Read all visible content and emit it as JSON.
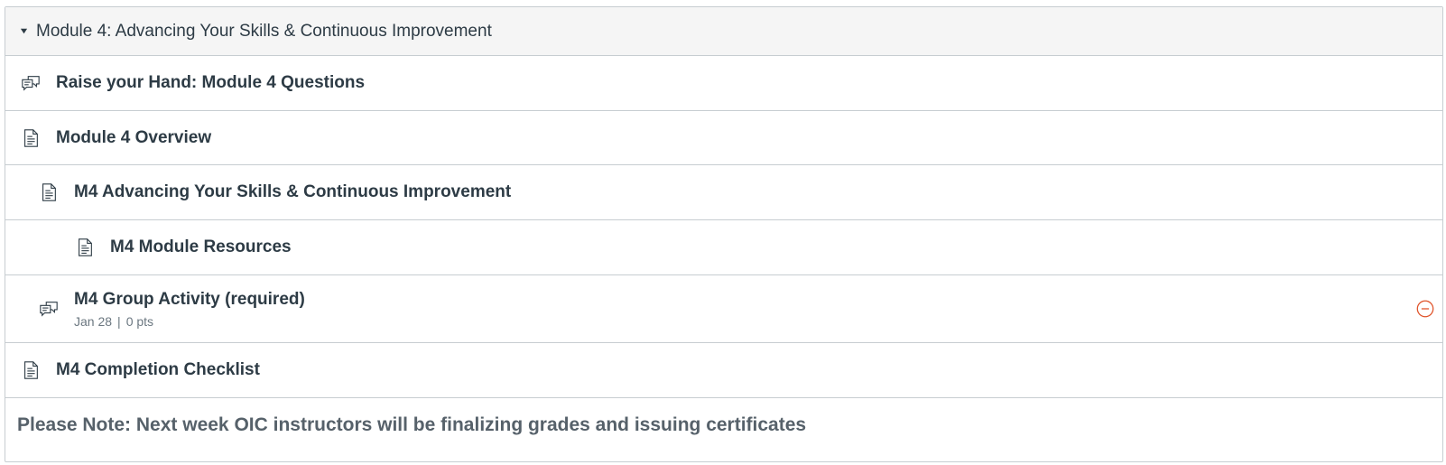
{
  "module": {
    "title": "Module 4: Advancing Your Skills & Continuous Improvement",
    "expanded": true,
    "items": [
      {
        "type": "discussion",
        "icon": "discussion-icon",
        "title": "Raise your Hand: Module 4 Questions",
        "indent": 0
      },
      {
        "type": "page",
        "icon": "page-icon",
        "title": "Module 4 Overview",
        "indent": 0
      },
      {
        "type": "page",
        "icon": "page-icon",
        "title": "M4 Advancing Your Skills & Continuous Improvement",
        "indent": 1
      },
      {
        "type": "page",
        "icon": "page-icon",
        "title": "M4 Module Resources",
        "indent": 2
      },
      {
        "type": "discussion",
        "icon": "discussion-icon",
        "title": "M4 Group Activity (required)",
        "indent": 1,
        "due": "Jan 28",
        "meta_separator": "|",
        "points": "0 pts",
        "status_icon": "minus-circle-icon",
        "status_color": "#e0542b"
      },
      {
        "type": "page",
        "icon": "page-icon",
        "title": "M4 Completion Checklist",
        "indent": 0
      }
    ],
    "note": "Please Note: Next week OIC instructors will be finalizing grades and issuing certificates"
  }
}
